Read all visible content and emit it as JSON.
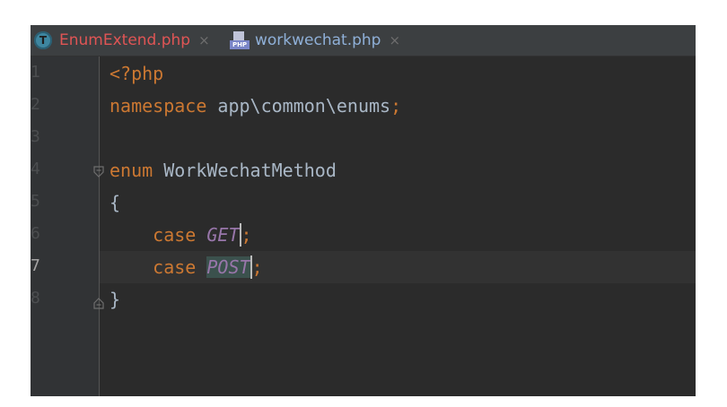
{
  "tabs": [
    {
      "icon": "T",
      "label": "EnumExtend.php",
      "close": "×"
    },
    {
      "icon": "PHP",
      "label": "workwechat.php",
      "close": "×"
    }
  ],
  "gutter": {
    "line_numbers": [
      "1",
      "2",
      "3",
      "4",
      "5",
      "6",
      "7",
      "8"
    ]
  },
  "code": {
    "line1": {
      "tag": "<?php"
    },
    "line2": {
      "kw": "namespace",
      "rest": " app\\common\\enums",
      "semi": ";"
    },
    "line4": {
      "kw": "enum",
      "rest": " WorkWechatMethod"
    },
    "line5": {
      "brace": "{"
    },
    "line6": {
      "kw": "case",
      "const": "GET",
      "semi": ";"
    },
    "line7": {
      "kw": "case",
      "const": "POST",
      "semi": ";"
    },
    "line8": {
      "brace": "}"
    }
  },
  "colors": {
    "background": "#2b2b2b",
    "gutter": "#313335",
    "keyword": "#cc7832",
    "text": "#a9b7c6",
    "constant": "#9876aa",
    "active_tab_text": "#e05555",
    "tab_text": "#8fb0d8"
  }
}
